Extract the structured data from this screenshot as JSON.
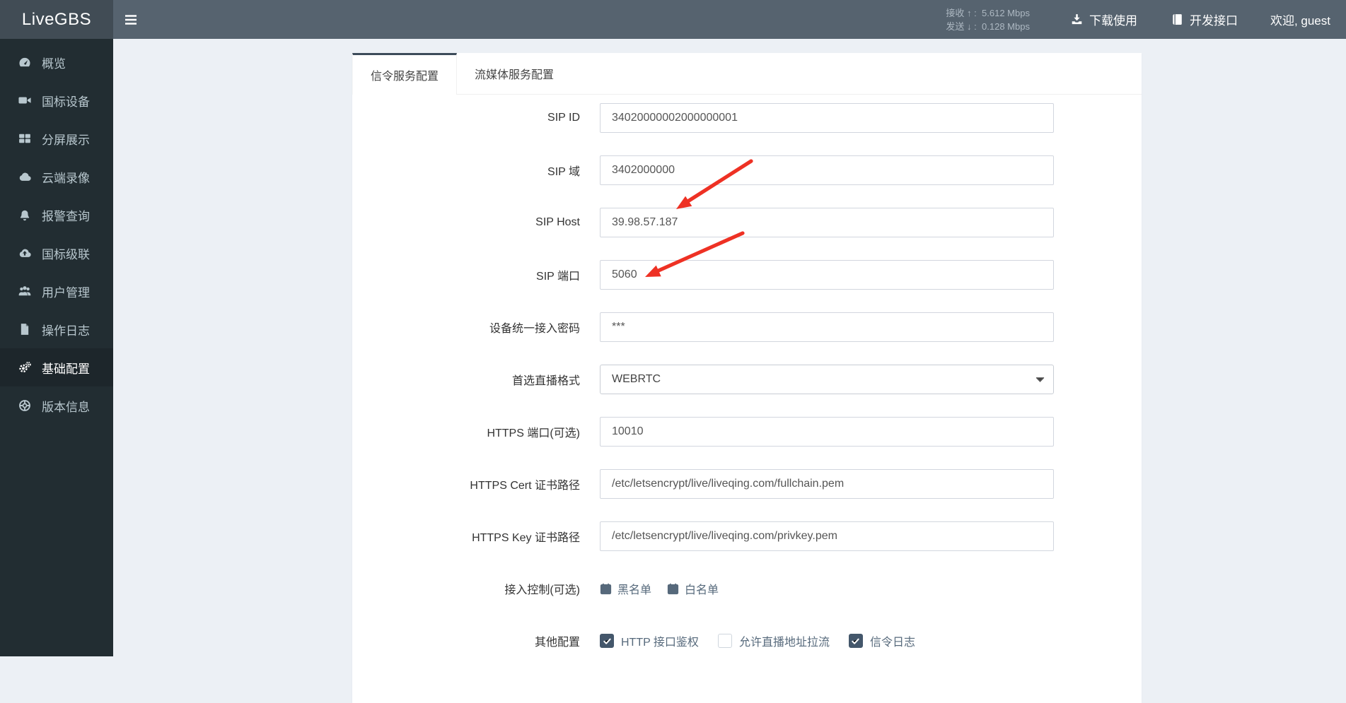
{
  "app": {
    "logo": "LiveGBS"
  },
  "navbar": {
    "stats": {
      "recv_label": "接收",
      "recv_arrow": "↑",
      "recv_value": "5.612 Mbps",
      "send_label": "发送",
      "send_arrow": "↓",
      "send_value": "0.128 Mbps",
      "separator": ":"
    },
    "download_label": "下载使用",
    "dev_api_label": "开发接口",
    "welcome_label": "欢迎, guest"
  },
  "sidebar": {
    "items": [
      {
        "label": "概览",
        "icon": "gauge-icon",
        "active": false
      },
      {
        "label": "国标设备",
        "icon": "video-camera-icon",
        "active": false
      },
      {
        "label": "分屏展示",
        "icon": "grid-icon",
        "active": false
      },
      {
        "label": "云端录像",
        "icon": "cloud-icon",
        "active": false
      },
      {
        "label": "报警查询",
        "icon": "bell-icon",
        "active": false
      },
      {
        "label": "国标级联",
        "icon": "cloud-upload-icon",
        "active": false
      },
      {
        "label": "用户管理",
        "icon": "users-icon",
        "active": false
      },
      {
        "label": "操作日志",
        "icon": "file-icon",
        "active": false
      },
      {
        "label": "基础配置",
        "icon": "gears-icon",
        "active": true
      },
      {
        "label": "版本信息",
        "icon": "info-ring-icon",
        "active": false
      }
    ]
  },
  "main": {
    "tabs": [
      {
        "label": "信令服务配置",
        "active": true
      },
      {
        "label": "流媒体服务配置",
        "active": false
      }
    ],
    "form": {
      "rows": [
        {
          "type": "text",
          "label": "SIP ID",
          "value": "34020000002000000001"
        },
        {
          "type": "text",
          "label": "SIP 域",
          "value": "3402000000"
        },
        {
          "type": "text",
          "label": "SIP Host",
          "value": "39.98.57.187",
          "annotated": true
        },
        {
          "type": "text",
          "label": "SIP 端口",
          "value": "5060",
          "annotated": true
        },
        {
          "type": "text",
          "label": "设备统一接入密码",
          "value": "***"
        },
        {
          "type": "select",
          "label": "首选直播格式",
          "value": "WEBRTC"
        },
        {
          "type": "text",
          "label": "HTTPS 端口(可选)",
          "value": "10010"
        },
        {
          "type": "text",
          "label": "HTTPS Cert 证书路径",
          "value": "/etc/letsencrypt/live/liveqing.com/fullchain.pem"
        },
        {
          "type": "text",
          "label": "HTTPS Key 证书路径",
          "value": "/etc/letsencrypt/live/liveqing.com/privkey.pem"
        },
        {
          "type": "links",
          "label": "接入控制(可选)",
          "links": [
            {
              "label": "黑名单",
              "icon": "calendar-times-icon"
            },
            {
              "label": "白名单",
              "icon": "calendar-check-icon"
            }
          ]
        },
        {
          "type": "checkboxes",
          "label": "其他配置",
          "options": [
            {
              "label": "HTTP 接口鉴权",
              "checked": true
            },
            {
              "label": "允许直播地址拉流",
              "checked": false
            },
            {
              "label": "信令日志",
              "checked": true
            }
          ]
        }
      ]
    }
  },
  "colors": {
    "navbar_bg": "#56636f",
    "logo_bg": "#414c55",
    "sidebar_bg": "#222d32",
    "sidebar_active_bg": "#1d262b",
    "content_bg": "#ecf0f5",
    "tab_active_border": "#3c4b5a",
    "input_border": "#d2d6de",
    "checkbox_checked": "#44576b",
    "slate_link": "#56697b",
    "annotation_red": "#ee3124"
  }
}
